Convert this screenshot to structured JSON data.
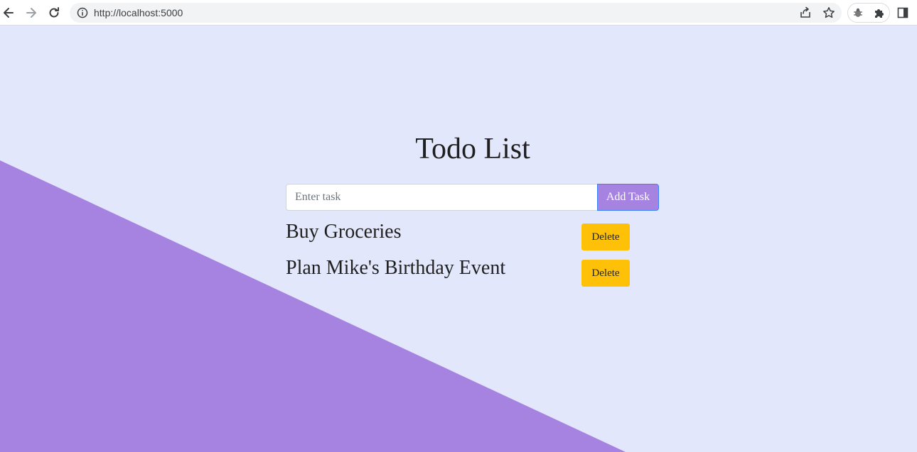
{
  "browser": {
    "url": "http://localhost:5000"
  },
  "app": {
    "title": "Todo List",
    "input_placeholder": "Enter task",
    "add_label": "Add Task",
    "tasks": [
      {
        "text": "Buy Groceries",
        "delete_label": "Delete"
      },
      {
        "text": "Plan Mike's Birthday Event",
        "delete_label": "Delete"
      }
    ]
  },
  "colors": {
    "background": "#e2e7fb",
    "accent_purple": "#a783e1",
    "delete_yellow": "#ffc107"
  },
  "icons": {
    "back": "arrow-left-icon",
    "forward": "arrow-right-icon",
    "reload": "reload-icon",
    "info": "info-icon",
    "share": "share-icon",
    "bookmark": "star-icon",
    "bug": "bug-icon",
    "extensions": "puzzle-icon",
    "side_panel": "side-panel-icon"
  }
}
